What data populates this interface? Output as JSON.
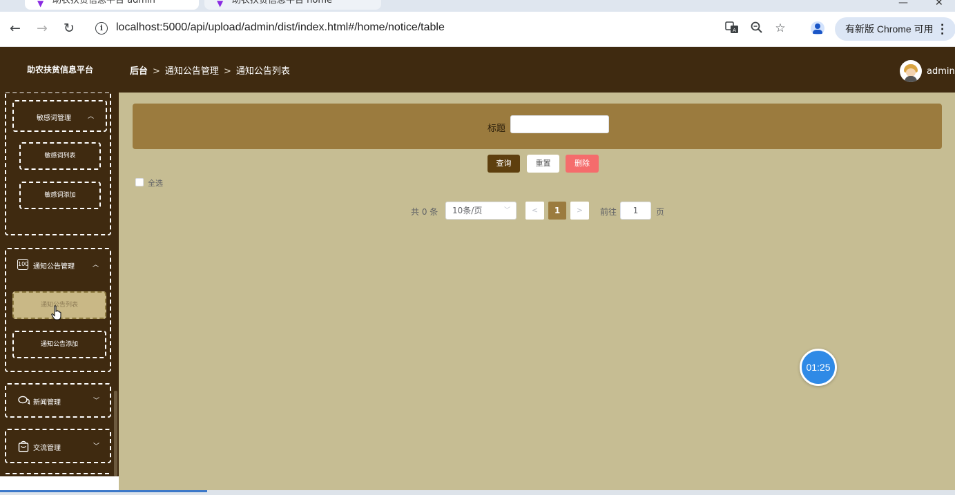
{
  "browser": {
    "tabs": [
      {
        "label": "助农扶贫信息平台 admin"
      },
      {
        "label": "助农扶贫信息平台 home"
      }
    ],
    "url": "localhost:5000/api/upload/admin/dist/index.html#/home/notice/table",
    "update_label": "有新版 Chrome 可用",
    "icons": [
      "back-icon",
      "forward-icon",
      "reload-icon",
      "site-info-icon",
      "translate-icon",
      "zoom-icon",
      "bookmark-star-icon",
      "profile-icon",
      "menu-dots-icon"
    ]
  },
  "header": {
    "platform_name": "助农扶贫信息平台",
    "breadcrumb": [
      "后台",
      "通知公告管理",
      "通知公告列表"
    ],
    "username": "admin"
  },
  "sidebar": {
    "groups": [
      {
        "title": "敏感词管理",
        "expanded": true,
        "items": [
          "敏感词列表",
          "敏感词添加"
        ]
      },
      {
        "title": "通知公告管理",
        "icon": "notice-icon",
        "expanded": true,
        "items": [
          "通知公告列表",
          "通知公告添加"
        ],
        "active_item": "通知公告列表"
      },
      {
        "title": "新闻管理",
        "icon": "chat-bubble-icon",
        "expanded": false
      },
      {
        "title": "交流管理",
        "icon": "bag-icon",
        "expanded": false
      }
    ]
  },
  "filter": {
    "label": "标题",
    "value": ""
  },
  "actions": {
    "query": "查询",
    "reset": "重置",
    "delete": "删除"
  },
  "select_all": "全选",
  "pagination": {
    "total": "共 0 条",
    "page_size": "10条/页",
    "current_page": "1",
    "goto_label": "前往",
    "goto_value": "1",
    "page_unit": "页"
  },
  "timer": "01:25",
  "colors": {
    "header_bg": "#3f2a10",
    "content_bg": "#c6bd93",
    "search_bar_bg": "#9b7b3e",
    "query_button": "#5e3f0e",
    "delete_button": "#f56c6c",
    "timer_bg": "#2f8ae6"
  }
}
